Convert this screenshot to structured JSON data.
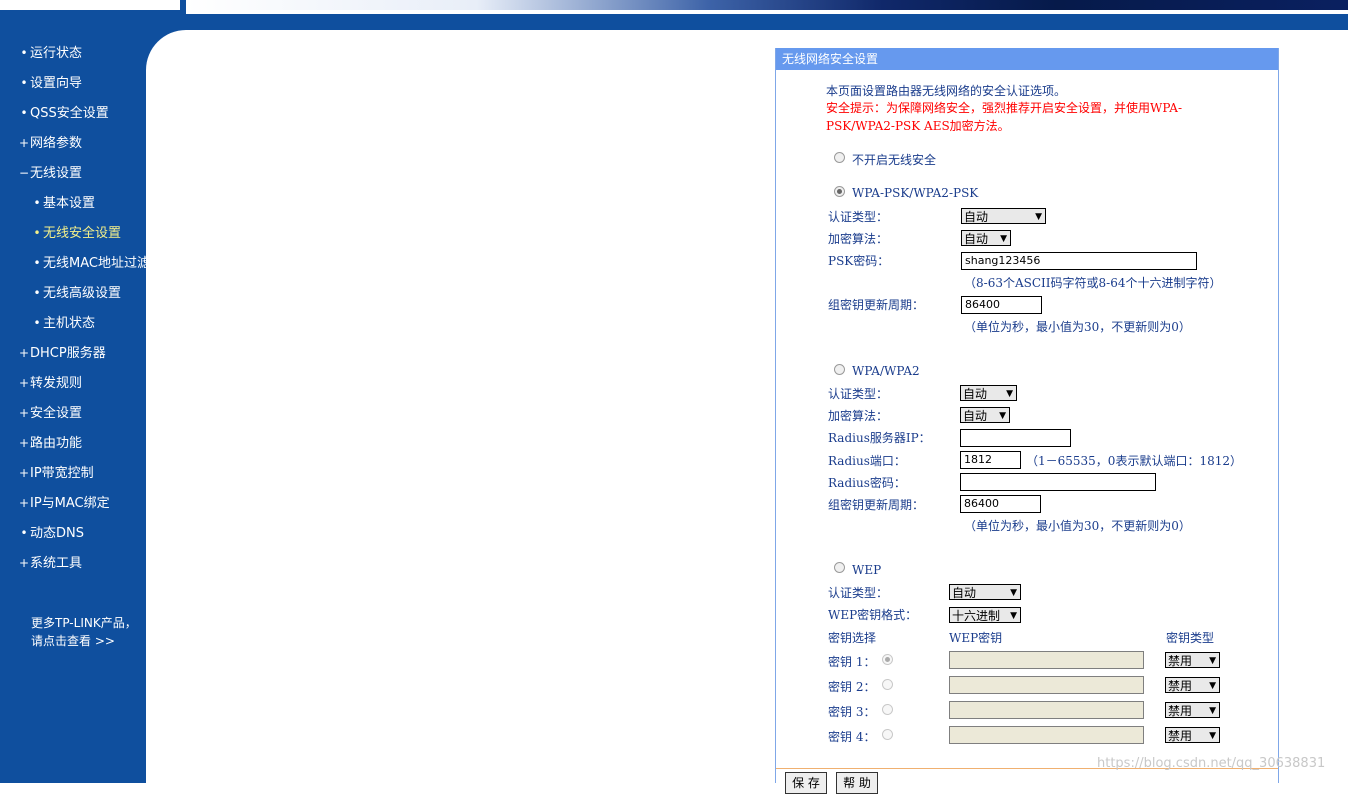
{
  "sidebar": {
    "items": [
      {
        "bullet": "•",
        "label": "运行状态"
      },
      {
        "bullet": "•",
        "label": "设置向导"
      },
      {
        "bullet": "•",
        "label": "QSS安全设置"
      },
      {
        "bullet": "+",
        "label": "网络参数"
      },
      {
        "bullet": "−",
        "label": "无线设置"
      },
      {
        "bullet": "•",
        "label": "基本设置"
      },
      {
        "bullet": "•",
        "label": "无线安全设置"
      },
      {
        "bullet": "•",
        "label": "无线MAC地址过滤"
      },
      {
        "bullet": "•",
        "label": "无线高级设置"
      },
      {
        "bullet": "•",
        "label": "主机状态"
      },
      {
        "bullet": "+",
        "label": "DHCP服务器"
      },
      {
        "bullet": "+",
        "label": "转发规则"
      },
      {
        "bullet": "+",
        "label": "安全设置"
      },
      {
        "bullet": "+",
        "label": "路由功能"
      },
      {
        "bullet": "+",
        "label": "IP带宽控制"
      },
      {
        "bullet": "+",
        "label": "IP与MAC绑定"
      },
      {
        "bullet": "•",
        "label": "动态DNS"
      },
      {
        "bullet": "+",
        "label": "系统工具"
      }
    ],
    "more_line1": "更多TP-LINK产品，",
    "more_line2": "请点击查看 >>"
  },
  "panel": {
    "title": "无线网络安全设置",
    "intro": "本页面设置路由器无线网络的安全认证选项。",
    "warning_line1": "安全提示：为保障网络安全，强烈推荐开启安全设置，并使用WPA-",
    "warning_line2": "PSK/WPA2-PSK AES加密方法。",
    "none_option": "不开启无线安全",
    "wpa_psk": {
      "label": "WPA-PSK/WPA2-PSK",
      "auth_label": "认证类型：",
      "auth_value": "自动",
      "enc_label": "加密算法：",
      "enc_value": "自动",
      "psk_label": "PSK密码：",
      "psk_value": "shang123456",
      "psk_hint": "（8-63个ASCII码字符或8-64个十六进制字符）",
      "period_label": "组密钥更新周期：",
      "period_value": "86400",
      "period_hint": "（单位为秒，最小值为30，不更新则为0）"
    },
    "wpa": {
      "label": "WPA/WPA2",
      "auth_label": "认证类型：",
      "auth_value": "自动",
      "enc_label": "加密算法：",
      "enc_value": "自动",
      "radius_ip_label": "Radius服务器IP：",
      "radius_ip_value": "",
      "radius_port_label": "Radius端口：",
      "radius_port_value": "1812",
      "radius_port_hint": "（1－65535，0表示默认端口：1812）",
      "radius_pwd_label": "Radius密码：",
      "radius_pwd_value": "",
      "period_label": "组密钥更新周期：",
      "period_value": "86400",
      "period_hint": "（单位为秒，最小值为30，不更新则为0）"
    },
    "wep": {
      "label": "WEP",
      "auth_label": "认证类型：",
      "auth_value": "自动",
      "format_label": "WEP密钥格式：",
      "format_value": "十六进制",
      "col_select": "密钥选择",
      "col_key": "WEP密钥",
      "col_type": "密钥类型",
      "keys": [
        {
          "label": "密钥 1：",
          "value": "",
          "type": "禁用"
        },
        {
          "label": "密钥 2：",
          "value": "",
          "type": "禁用"
        },
        {
          "label": "密钥 3：",
          "value": "",
          "type": "禁用"
        },
        {
          "label": "密钥 4：",
          "value": "",
          "type": "禁用"
        }
      ]
    },
    "save_label": "保 存",
    "help_label": "帮 助"
  },
  "watermark": "https://blog.csdn.net/qq_30638831"
}
